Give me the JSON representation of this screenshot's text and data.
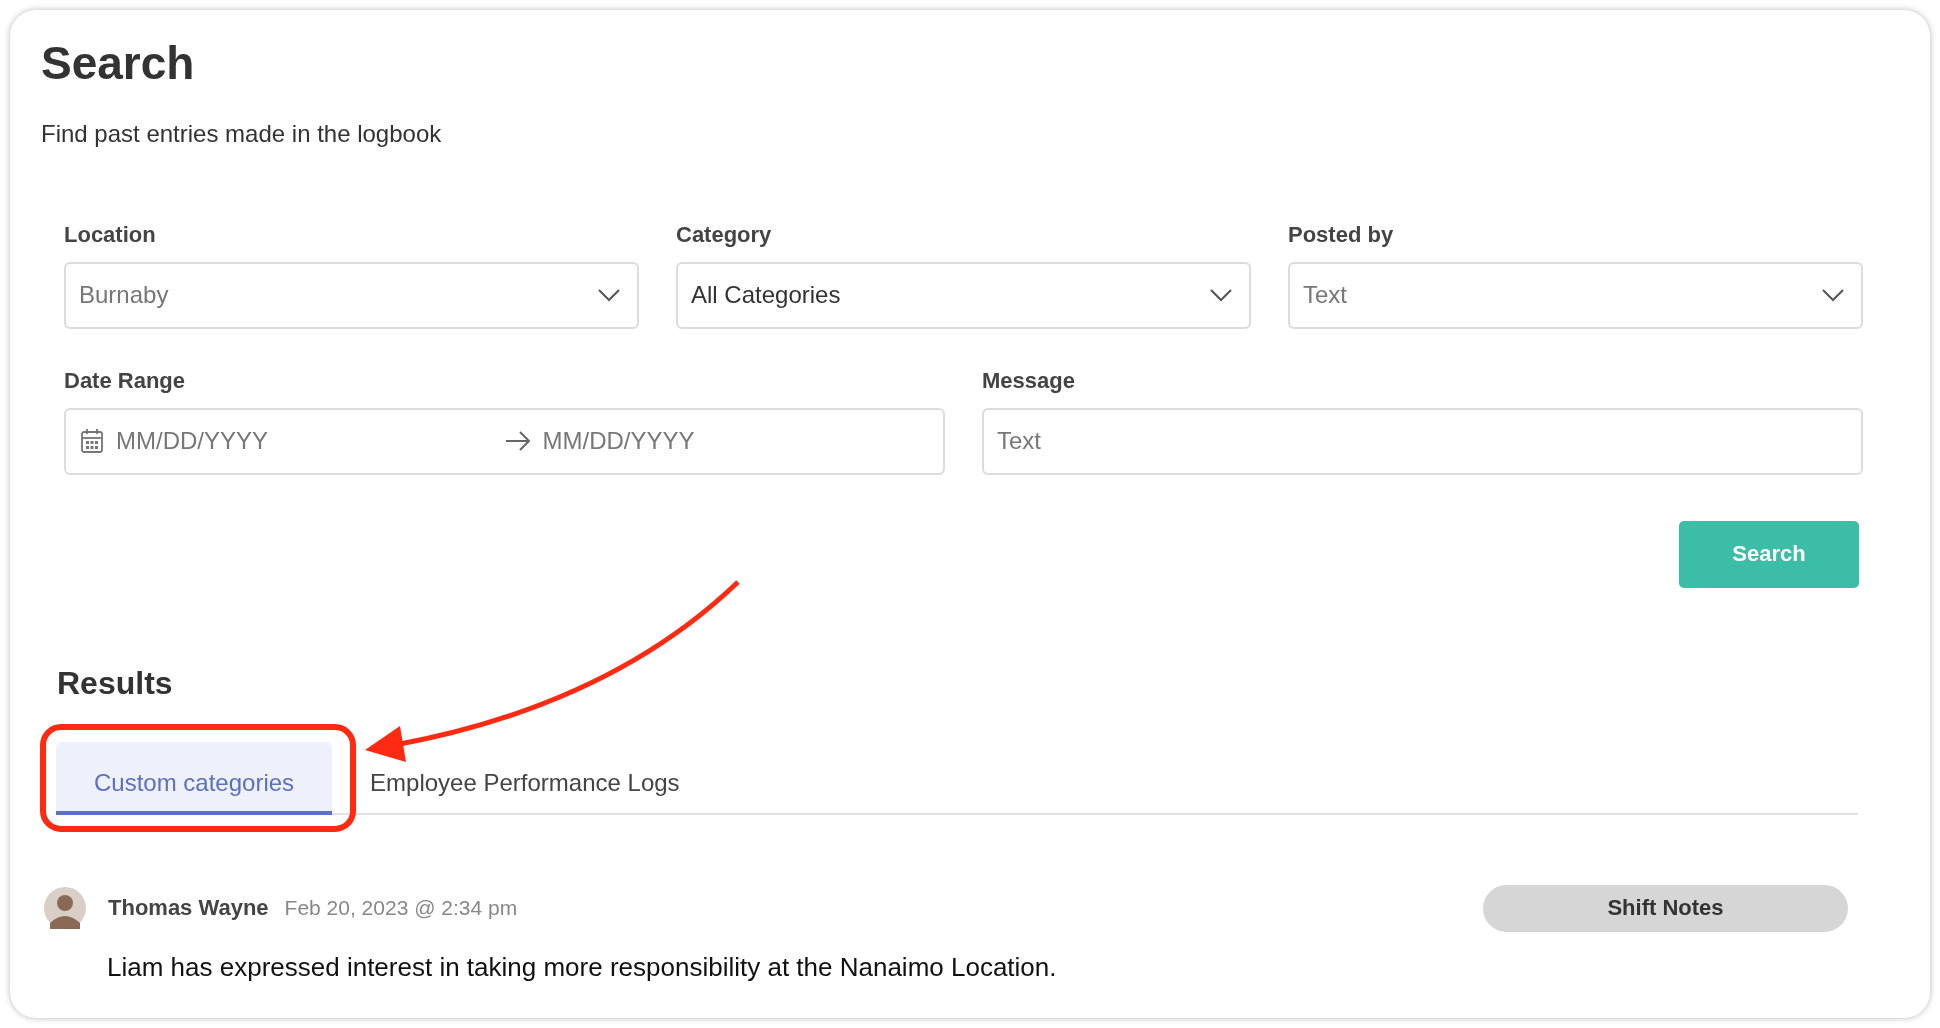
{
  "title": "Search",
  "subtitle": "Find past entries made in the logbook",
  "filters": [
    {
      "label": "Location",
      "kind": "select",
      "placeholder": "Burnaby"
    },
    {
      "label": "Category",
      "kind": "select",
      "value": "All Categories"
    },
    {
      "label": "Posted by",
      "kind": "select",
      "placeholder": "Text"
    }
  ],
  "date_range": {
    "label": "Date Range",
    "start_placeholder": "MM/DD/YYYY",
    "end_placeholder": "MM/DD/YYYY"
  },
  "message": {
    "label": "Message",
    "placeholder": "Text"
  },
  "search_button": "Search",
  "results": {
    "heading": "Results",
    "tabs": [
      {
        "label": "Custom categories",
        "selected": true
      },
      {
        "label": "Employee Performance Logs",
        "selected": false
      }
    ],
    "entries": [
      {
        "author": "Thomas Wayne",
        "timestamp": "Feb 20, 2023 @ 2:34 pm",
        "tag": "Shift Notes",
        "message": "Liam has expressed interest in taking more responsibility at the Nanaimo Location."
      }
    ]
  },
  "annotation": {
    "kind": "callout"
  }
}
